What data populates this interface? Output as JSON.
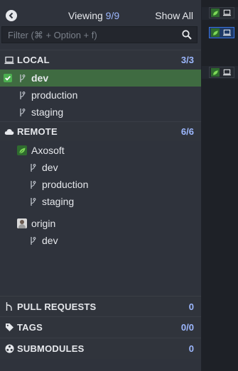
{
  "header": {
    "viewing_label": "Viewing",
    "viewing_shown": "9",
    "viewing_total": "9",
    "show_all_label": "Show All"
  },
  "filter": {
    "placeholder": "Filter (⌘ + Option + f)"
  },
  "local": {
    "label": "LOCAL",
    "count_shown": "3",
    "count_total": "3",
    "branches": [
      {
        "name": "dev",
        "checked_out": true
      },
      {
        "name": "production",
        "checked_out": false
      },
      {
        "name": "staging",
        "checked_out": false
      }
    ]
  },
  "remote": {
    "label": "REMOTE",
    "count_shown": "6",
    "count_total": "6",
    "remotes": [
      {
        "name": "Axosoft",
        "branches": [
          "dev",
          "production",
          "staging"
        ]
      },
      {
        "name": "origin",
        "branches": [
          "dev"
        ]
      }
    ]
  },
  "pull_requests": {
    "label": "PULL REQUESTS",
    "count": "0"
  },
  "tags": {
    "label": "TAGS",
    "count_shown": "0",
    "count_total": "0"
  },
  "submodules": {
    "label": "SUBMODULES",
    "count": "0"
  },
  "colors": {
    "panel_bg": "#2f333c",
    "active_row": "#3f6b41",
    "accent_count": "#9db8ff",
    "checkbox": "#4caf50",
    "graph_selected": "#3b74e0"
  }
}
